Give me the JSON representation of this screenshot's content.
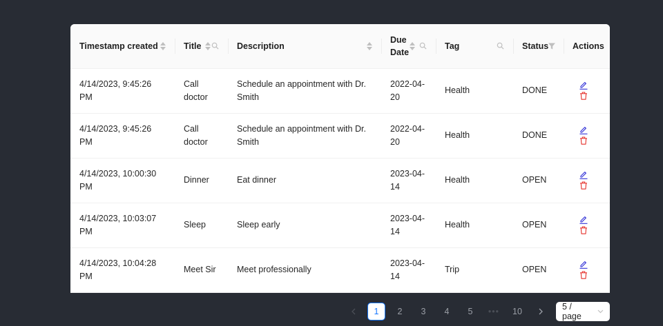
{
  "table": {
    "columns": {
      "timestamp": "Timestamp created",
      "title": "Title",
      "description": "Description",
      "due_date": "Due Date",
      "tag": "Tag",
      "status": "Status",
      "actions": "Actions"
    },
    "rows": [
      {
        "timestamp": "4/14/2023, 9:45:26 PM",
        "title": "Call doctor",
        "description": "Schedule an appointment with Dr. Smith",
        "due_date": "2022-04-20",
        "tag": "Health",
        "status": "DONE"
      },
      {
        "timestamp": "4/14/2023, 9:45:26 PM",
        "title": "Call doctor",
        "description": "Schedule an appointment with Dr. Smith",
        "due_date": "2022-04-20",
        "tag": "Health",
        "status": "DONE"
      },
      {
        "timestamp": "4/14/2023, 10:00:30 PM",
        "title": "Dinner",
        "description": "Eat dinner",
        "due_date": "2023-04-14",
        "tag": "Health",
        "status": "OPEN"
      },
      {
        "timestamp": "4/14/2023, 10:03:07 PM",
        "title": "Sleep",
        "description": "Sleep early",
        "due_date": "2023-04-14",
        "tag": "Health",
        "status": "OPEN"
      },
      {
        "timestamp": "4/14/2023, 10:04:28 PM",
        "title": "Meet Sir",
        "description": "Meet professionally",
        "due_date": "2023-04-14",
        "tag": "Trip",
        "status": "OPEN"
      }
    ]
  },
  "pagination": {
    "pages": [
      "1",
      "2",
      "3",
      "4",
      "5"
    ],
    "ellipsis": "•••",
    "last_page": "10",
    "current": "1",
    "page_size": "5 / page"
  },
  "icons": {
    "edit": "edit-icon",
    "delete": "delete-icon",
    "sort": "sort-icon",
    "search": "search-icon",
    "filter": "filter-icon"
  },
  "colors": {
    "background": "#282c34",
    "edit": "#2f2fd6",
    "delete": "#e5312b",
    "accent": "#1677ff"
  }
}
